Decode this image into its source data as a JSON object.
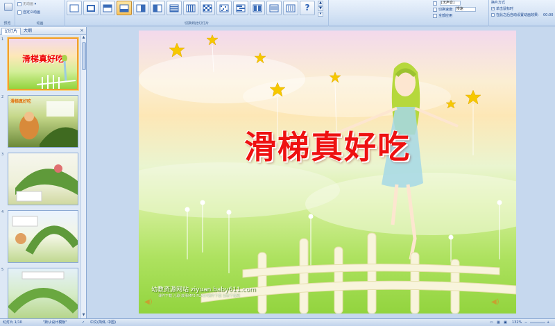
{
  "ribbon": {
    "preview_label": "预览",
    "animation_group_label": "动画",
    "animation_dropdown_value": "无动画",
    "custom_animation_label": "自定义动画",
    "transition_group_label": "切换到此幻灯片",
    "help_label": "?",
    "sound_value": "[无声音]",
    "speed_label": "切换速度:",
    "speed_value": "慢速",
    "apply_all_label": "全部应用",
    "advance_label": "换片方式",
    "on_click_label": "单击鼠标时",
    "auto_after_label": "在此之后自动设置动画效果:",
    "auto_time_value": "00:00"
  },
  "panel": {
    "tab_slides": "幻灯片",
    "tab_outline": "大纲",
    "close": "×",
    "slide1_title": "滑梯真好吃",
    "slide2_title": "滑梯真好吃",
    "numbers": [
      "1",
      "2",
      "3",
      "4",
      "5"
    ]
  },
  "slide": {
    "title": "滑梯真好吃",
    "site": "幼教资源网站  ziyuan.baby611.com",
    "links": "课件下载   儿歌·故事MP3   FLASH课件下载   试卷下载网"
  },
  "status": {
    "slide_info": "幻灯片 1/10",
    "theme": "\"默认设计模板\"",
    "language": "中文(简体, 中国)",
    "zoom": "132%"
  }
}
